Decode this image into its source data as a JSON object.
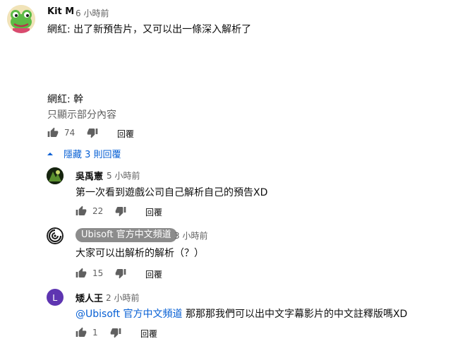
{
  "main_comment": {
    "author": "Kit M",
    "time": "6 小時前",
    "text_line1": "網紅: 出了新預告片，又可以出一條深入解析了",
    "text_line2": "網紅: 幹",
    "show_less": "只顯示部分內容",
    "likes": "74",
    "reply_label": "回覆",
    "hide_replies": "隱藏 3 則回覆"
  },
  "replies": [
    {
      "author": "吳禹憲",
      "time": "5 小時前",
      "text": "第一次看到遊戲公司自己解析自己的預告XD",
      "likes": "22",
      "reply_label": "回覆"
    },
    {
      "author": "Ubisoft 官方中文頻道",
      "time": "3 小時前",
      "text": "大家可以出解析的解析（？）",
      "likes": "15",
      "reply_label": "回覆"
    },
    {
      "author": "矮人王",
      "avatar_letter": "L",
      "time": "2 小時前",
      "mention": "@Ubisoft 官方中文頻道",
      "text": " 那那那我們可以出中文字幕影片的中文註釋版嗎XD",
      "likes": "1",
      "reply_label": "回覆"
    }
  ],
  "colors": {
    "link": "#065fd4",
    "avatar_L": "#5e35b1",
    "badge": "#8c8c8c"
  },
  "icons": [
    "like-icon",
    "dislike-icon",
    "chevron-up-icon",
    "ubisoft-logo-icon",
    "frog-avatar-icon"
  ]
}
